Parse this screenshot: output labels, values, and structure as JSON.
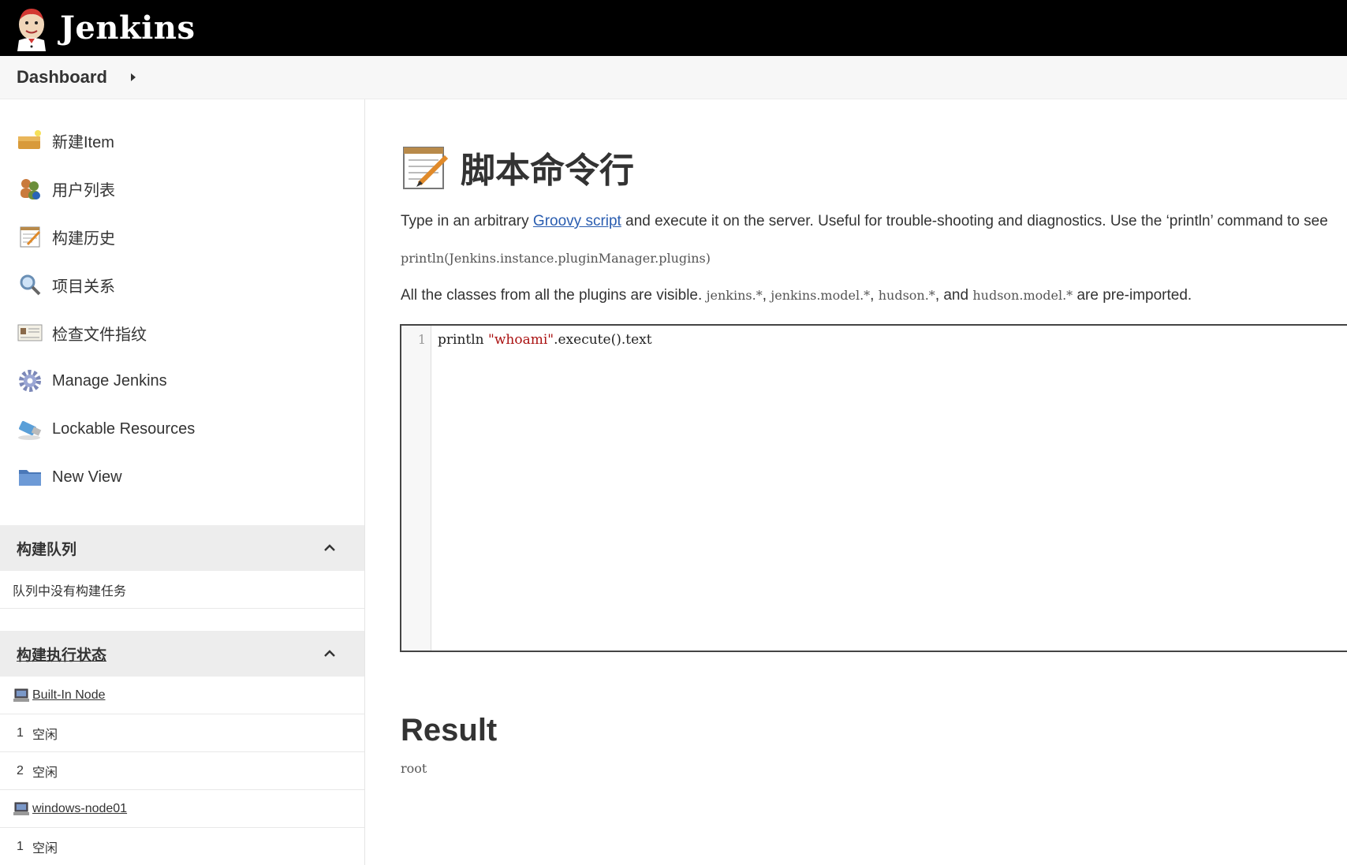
{
  "header": {
    "brand": "Jenkins"
  },
  "breadcrumb": {
    "items": [
      "Dashboard"
    ]
  },
  "sidebar": {
    "tasks": [
      {
        "label": "新建Item",
        "icon": "new-item-icon"
      },
      {
        "label": "用户列表",
        "icon": "users-icon"
      },
      {
        "label": "构建历史",
        "icon": "notepad-icon"
      },
      {
        "label": "项目关系",
        "icon": "search-icon"
      },
      {
        "label": "检查文件指纹",
        "icon": "fingerprint-icon"
      },
      {
        "label": "Manage Jenkins",
        "icon": "gear-icon"
      },
      {
        "label": "Lockable Resources",
        "icon": "usb-icon"
      },
      {
        "label": "New View",
        "icon": "folder-icon"
      }
    ],
    "build_queue": {
      "title": "构建队列",
      "empty_text": "队列中没有构建任务"
    },
    "executors": {
      "title": "构建执行状态",
      "nodes": [
        {
          "name": "Built-In Node",
          "executors": [
            {
              "num": "1",
              "status": "空闲"
            },
            {
              "num": "2",
              "status": "空闲"
            }
          ]
        },
        {
          "name": "windows-node01",
          "executors": [
            {
              "num": "1",
              "status": "空闲"
            }
          ]
        }
      ]
    }
  },
  "main": {
    "title": "脚本命令行",
    "desc1_pre": "Type in an arbitrary ",
    "desc1_link": "Groovy script",
    "desc1_post": " and execute it on the server. Useful for trouble-shooting and diagnostics. Use the ‘println’ command to see",
    "example_code": "println(Jenkins.instance.pluginManager.plugins)",
    "desc2_pre": "All the classes from all the plugins are visible. ",
    "desc2_c1": "jenkins.*",
    "desc2_c2": "jenkins.model.*",
    "desc2_c3": "hudson.*",
    "desc2_and": ", and ",
    "desc2_c4": "hudson.model.*",
    "desc2_post": " are pre-imported.",
    "sep": ", ",
    "editor": {
      "line_number": "1",
      "code_prefix": "println ",
      "code_string": "\"whoami\"",
      "code_suffix": ".execute().text"
    },
    "result_heading": "Result",
    "result_value": "root"
  }
}
